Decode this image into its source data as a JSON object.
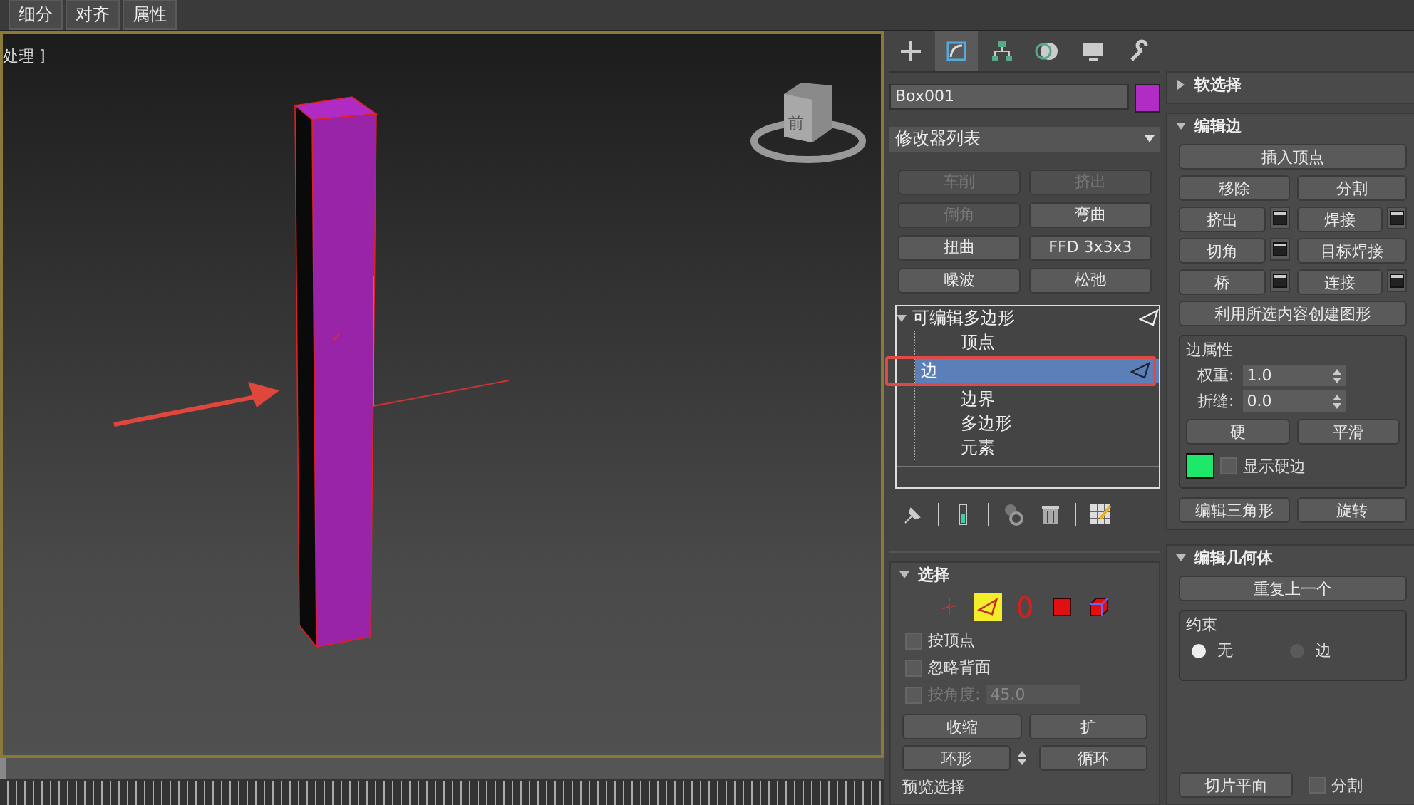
{
  "menu_tabs": [
    {
      "label": "细分"
    },
    {
      "label": "对齐"
    },
    {
      "label": "属性"
    }
  ],
  "viewport": {
    "label": "处理 ]",
    "viewcube_face": "前"
  },
  "time_slider": {
    "level": 0
  },
  "command_tabs": [
    {
      "kind": "create",
      "selected": false
    },
    {
      "kind": "modify",
      "selected": true
    },
    {
      "kind": "hierarchy",
      "selected": false
    },
    {
      "kind": "motion",
      "selected": false
    },
    {
      "kind": "display",
      "selected": false
    },
    {
      "kind": "utilities",
      "selected": false
    }
  ],
  "object": {
    "name": "Box001",
    "color": "#b02cc4"
  },
  "modifier_list": "修改器列表",
  "modifier_buttons": [
    {
      "label": "车削",
      "disabled": true
    },
    {
      "label": "挤出",
      "disabled": true
    },
    {
      "label": "倒角",
      "disabled": true
    },
    {
      "label": "弯曲",
      "disabled": false
    },
    {
      "label": "扭曲",
      "disabled": false
    },
    {
      "label": "FFD 3x3x3",
      "disabled": false
    },
    {
      "label": "噪波",
      "disabled": false
    },
    {
      "label": "松弛",
      "disabled": false
    }
  ],
  "stack": {
    "label": "可编辑多边形",
    "expanded": true,
    "children": [
      {
        "label": "顶点",
        "selected": false
      },
      {
        "label": "边",
        "selected": true
      },
      {
        "label": "边界",
        "selected": false
      },
      {
        "label": "多边形",
        "selected": false
      },
      {
        "label": "元素",
        "selected": false
      }
    ]
  },
  "stack_tools": [
    {
      "kind": "pin"
    },
    {
      "kind": "result"
    },
    {
      "kind": "unique"
    },
    {
      "kind": "delete"
    },
    {
      "kind": "configure"
    }
  ],
  "selection_rollout": {
    "title": "选择",
    "expanded": true,
    "levels": [
      {
        "kind": "vertex",
        "selected": false
      },
      {
        "kind": "edge",
        "selected": true
      },
      {
        "kind": "border",
        "selected": false
      },
      {
        "kind": "polygon",
        "selected": false
      },
      {
        "kind": "element",
        "selected": false
      }
    ],
    "options": [
      {
        "label": "按顶点",
        "checked": false,
        "disabled": false
      },
      {
        "label": "忽略背面",
        "checked": false,
        "disabled": false
      },
      {
        "label": "按角度:",
        "checked": false,
        "disabled": true,
        "value": "45.0"
      }
    ],
    "button_rows": [
      [
        {
          "label": "收缩",
          "spinner": false
        },
        {
          "label": "扩",
          "spinner": false
        }
      ],
      [
        {
          "label": "环形",
          "spinner": true
        },
        {
          "label": "循环",
          "spinner": false
        }
      ]
    ],
    "preview_label": "预览选择"
  },
  "soft_selection": {
    "title": "软选择",
    "expanded": false
  },
  "edit_edges": {
    "title": "编辑边",
    "expanded": true,
    "button_rows": [
      [
        {
          "label": "插入顶点",
          "settings": false
        }
      ],
      [
        {
          "label": "移除",
          "settings": false
        },
        {
          "label": "分割",
          "settings": false
        }
      ],
      [
        {
          "label": "挤出",
          "settings": true
        },
        {
          "label": "焊接",
          "settings": true
        }
      ],
      [
        {
          "label": "切角",
          "settings": true
        },
        {
          "label": "目标焊接",
          "settings": false
        }
      ],
      [
        {
          "label": "桥",
          "settings": true
        },
        {
          "label": "连接",
          "settings": true
        }
      ],
      [
        {
          "label": "利用所选内容创建图形",
          "settings": false
        }
      ]
    ],
    "properties": {
      "title": "边属性",
      "spinners": [
        {
          "label": "权重:",
          "value": "1.0"
        },
        {
          "label": "折缝:",
          "value": "0.0"
        }
      ],
      "buttons": [
        "硬",
        "平滑"
      ],
      "show_hard_edges": {
        "label": "显示硬边",
        "checked": false
      }
    },
    "bottom_buttons": [
      "编辑三角形",
      "旋转"
    ]
  },
  "edit_geometry": {
    "title": "编辑几何体",
    "expanded": true,
    "repeat_button": "重复上一个",
    "constraints": {
      "title": "约束",
      "options": [
        {
          "label": "无",
          "selected": true
        },
        {
          "label": "边",
          "selected": false
        }
      ]
    },
    "slice_button": "切片平面",
    "split": {
      "label": "分割",
      "checked": false
    }
  }
}
